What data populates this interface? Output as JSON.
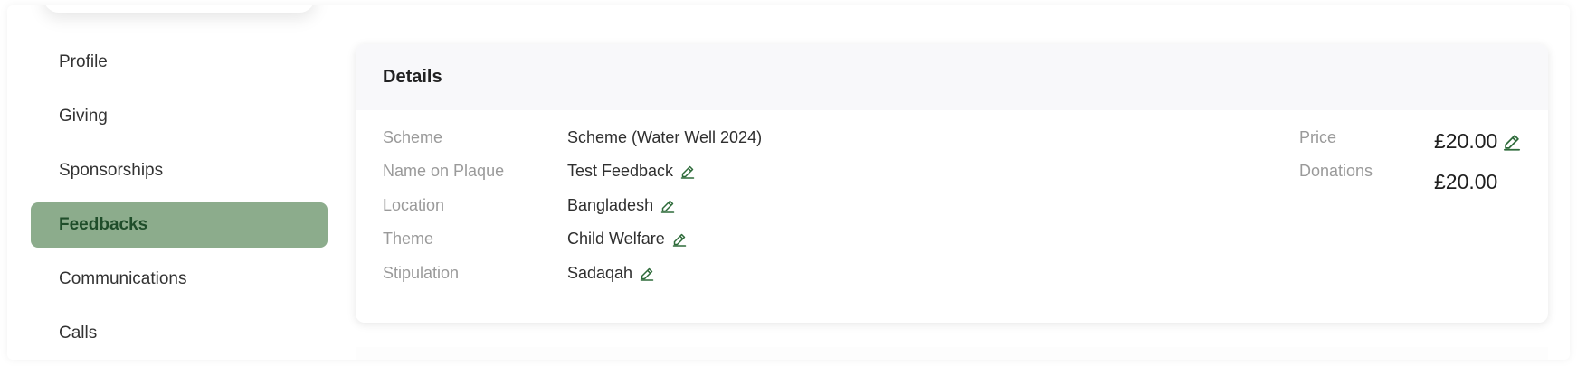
{
  "sidebar": {
    "items": [
      {
        "label": "Profile",
        "active": false
      },
      {
        "label": "Giving",
        "active": false
      },
      {
        "label": "Sponsorships",
        "active": false
      },
      {
        "label": "Feedbacks",
        "active": true
      },
      {
        "label": "Communications",
        "active": false
      },
      {
        "label": "Calls",
        "active": false
      }
    ]
  },
  "details": {
    "title": "Details",
    "fields": {
      "scheme": {
        "label": "Scheme",
        "value": "Scheme (Water Well 2024)"
      },
      "plaque": {
        "label": "Name on Plaque",
        "value": "Test Feedback"
      },
      "location": {
        "label": "Location",
        "value": "Bangladesh"
      },
      "theme": {
        "label": "Theme",
        "value": "Child Welfare"
      },
      "stipulation": {
        "label": "Stipulation",
        "value": "Sadaqah"
      }
    },
    "price": {
      "label": "Price",
      "value": "£20.00"
    },
    "donations": {
      "label": "Donations",
      "value": "£20.00"
    }
  },
  "colors": {
    "accent_bg": "#8cac8c",
    "accent_text": "#1f4d2a",
    "edit_icon": "#2e6b3a"
  },
  "icons": {
    "edit": "pencil-icon"
  }
}
